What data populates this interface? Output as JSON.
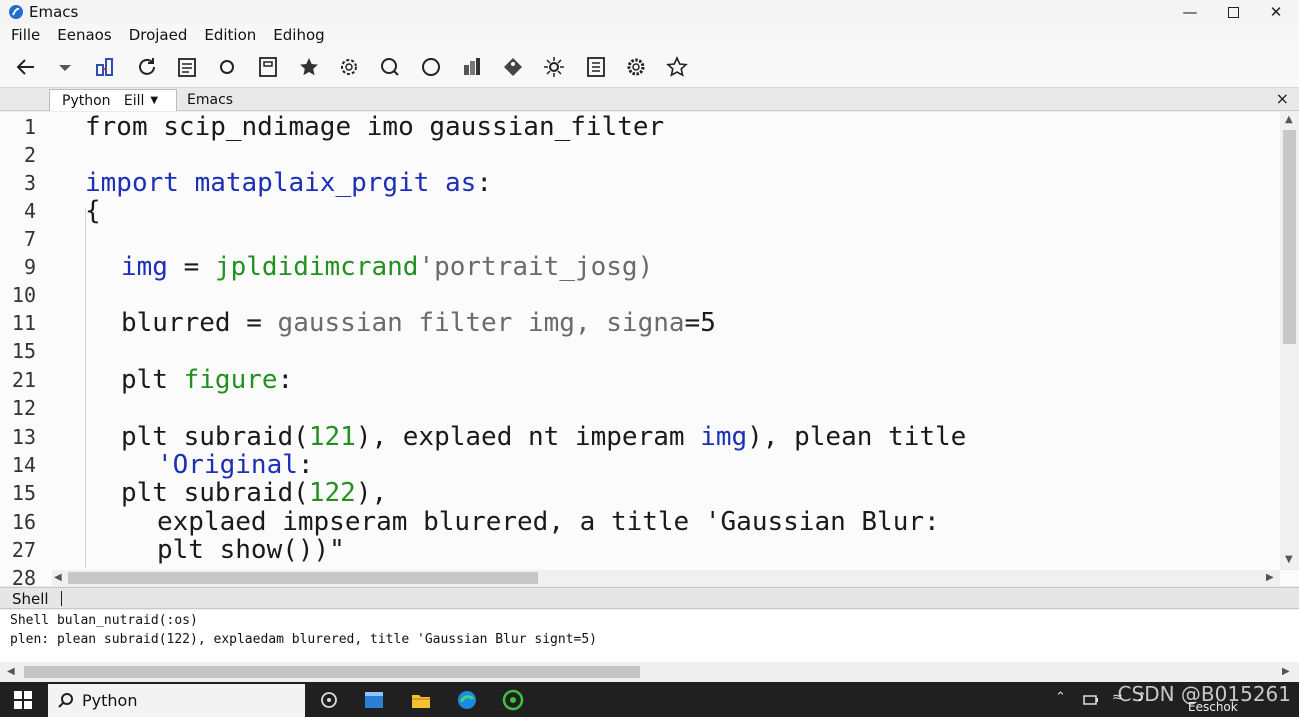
{
  "window": {
    "title": "Emacs"
  },
  "menu": [
    "Fille",
    "Eenaos",
    "Drojaed",
    "Edition",
    "Edihog"
  ],
  "toolbar_icons": [
    "back-arrow-icon",
    "dropdown-arrow-icon",
    "connect-icon",
    "refresh-icon",
    "document-icon",
    "circle-icon",
    "page-icon",
    "star-filled-icon",
    "gear-outline-icon",
    "search-circle-icon",
    "circle-outline-icon",
    "chart-icon",
    "tag-icon",
    "settings-sun-icon",
    "list-doc-icon",
    "cog-icon",
    "star-outline-icon"
  ],
  "tabs": {
    "active": "Python   Eill",
    "other": "Emacs",
    "close": "×"
  },
  "editor": {
    "line_numbers": [
      "1",
      "2",
      "3",
      "4",
      "7",
      "9",
      "10",
      "11",
      "15",
      "21",
      "12",
      "13",
      "14",
      "15",
      "16",
      "27",
      "28"
    ],
    "lines": {
      "l1": "from scip_ndimage imo gaussian_filter",
      "l3_kw": "import mataplaix_prgit as",
      "l3_end": ":",
      "l4": "{",
      "l9_var": "img",
      "l9_eq": " = ",
      "l9_fn": "jpldidimcrand",
      "l9_rest": "'portrait_josg)",
      "l11_a": "blurred = ",
      "l11_b": "gaussian filter img, signa",
      "l11_c": "=5",
      "l21_a": "plt ",
      "l21_b": "figure",
      "l21_c": ":",
      "l13_a": "plt subraid(",
      "l13_num": "121",
      "l13_b": "), explaed nt imperam ",
      "l13_img": "img",
      "l13_c": "), plean title",
      "l14_str": "'Original",
      "l14_end": ":",
      "l15_a": "plt subraid(",
      "l15_num": "122",
      "l15_b": "),",
      "l16": "explaed impseram blurered, a title 'Gaussian Blur:",
      "l27": "plt show())\""
    }
  },
  "shell": {
    "label": "Shell",
    "lines": [
      "Shell bulan_nutraid(:os)",
      "plen: plean subraid(122), explaedam blurered, title 'Gaussian Blur signt=5)"
    ]
  },
  "taskbar": {
    "search": "Python",
    "watermark": "CSDN @B015261",
    "tray_text": "Eeschok"
  }
}
